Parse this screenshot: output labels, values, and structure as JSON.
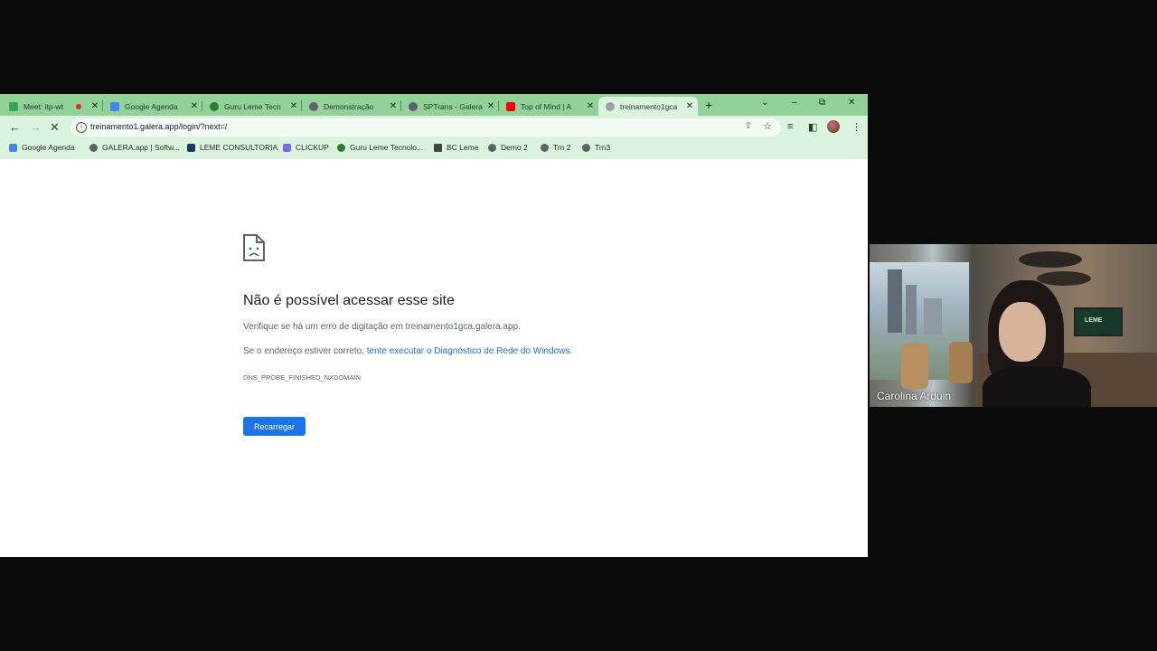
{
  "tabs": [
    {
      "title": "Meet: itp-wt",
      "favicon_color": "#34a853",
      "recording": true
    },
    {
      "title": "Google Agenda",
      "favicon_color": "#4285f4"
    },
    {
      "title": "Guru Leme Tecn",
      "favicon_color": "#2e7d32"
    },
    {
      "title": "Demonstração",
      "favicon_color": "#5f6368"
    },
    {
      "title": "SPTrans - Galera",
      "favicon_color": "#5f6368"
    },
    {
      "title": "Top of Mind | A",
      "favicon_color": "#ff0000"
    },
    {
      "title": "treinamento1gca",
      "favicon_color": "#9aa0a6"
    }
  ],
  "window_controls": {
    "list": "⌄",
    "minimize": "–",
    "restore": "⧉",
    "close": "✕"
  },
  "newtab_label": "+",
  "address": {
    "url": "treinamento1.galera.app/login/?next=/"
  },
  "bookmarks": [
    {
      "label": "Google Agenda",
      "color": "#4285f4"
    },
    {
      "label": "GALERA.app | Softw...",
      "color": "#5f6368"
    },
    {
      "label": "LEME CONSULTORIA",
      "color": "#1a3a6b"
    },
    {
      "label": "CLICKUP",
      "color": "#7b68ee"
    },
    {
      "label": "Guru Leme Tecnolo...",
      "color": "#2e7d32"
    },
    {
      "label": "BC Leme",
      "color": "#444444"
    },
    {
      "label": "Demo 2",
      "color": "#5f6368"
    },
    {
      "label": "Trn 2",
      "color": "#5f6368"
    },
    {
      "label": "Trn3",
      "color": "#5f6368"
    }
  ],
  "error": {
    "title": "Não é possível acessar esse site",
    "line1": "Verifique se há um erro de digitação em treinamento1gca.galera.app.",
    "line2_prefix": "Se o endereço estiver correto, ",
    "line2_link": "tente executar o Diagnóstico de Rede do Windows",
    "line2_suffix": ".",
    "code": "DNS_PROBE_FINISHED_NXDOMAIN",
    "reload_label": "Recarregar"
  },
  "video": {
    "participant_name": "Carolina Arduin",
    "tv_logo": "LEME"
  },
  "colors": {
    "tab_strip": "#93d19a",
    "toolbar": "#d9f3dc",
    "accent": "#1a73e8"
  }
}
